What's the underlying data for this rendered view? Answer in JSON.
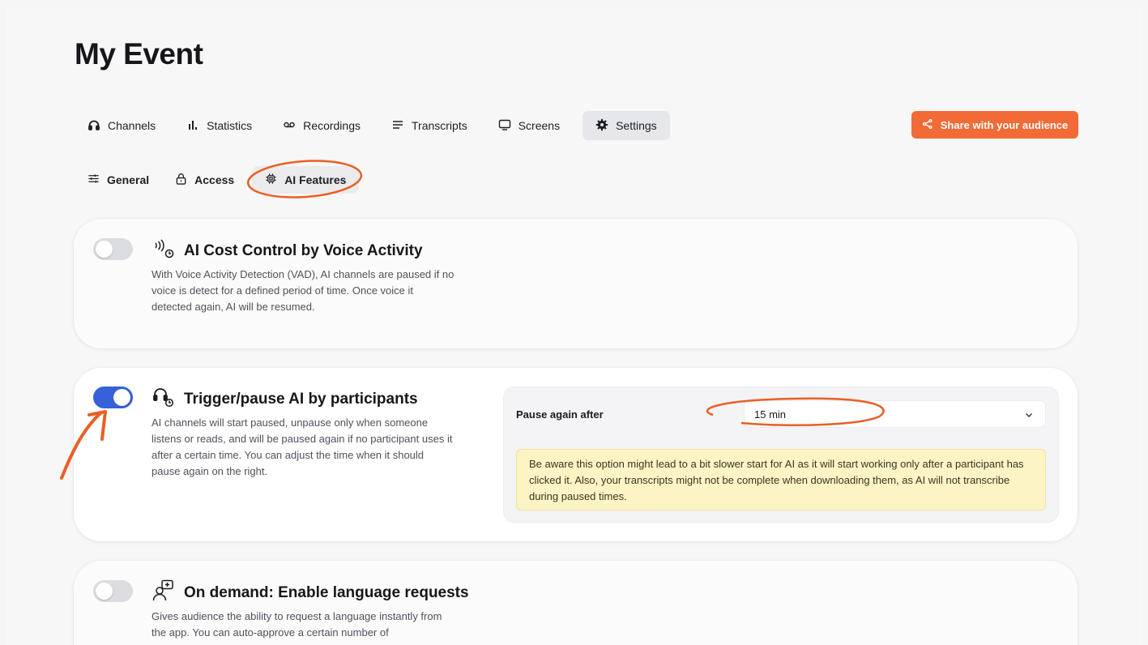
{
  "page_title": "My Event",
  "tabs": [
    {
      "label": "Channels",
      "icon": "headphones-icon"
    },
    {
      "label": "Statistics",
      "icon": "bar-chart-icon"
    },
    {
      "label": "Recordings",
      "icon": "voicemail-icon"
    },
    {
      "label": "Transcripts",
      "icon": "lines-icon"
    },
    {
      "label": "Screens",
      "icon": "monitor-icon"
    },
    {
      "label": "Settings",
      "icon": "gear-icon",
      "active": true
    }
  ],
  "share_button": {
    "label": "Share with your audience",
    "icon": "share-icon",
    "color": "#f26a35"
  },
  "subtabs": [
    {
      "label": "General",
      "icon": "sliders-icon"
    },
    {
      "label": "Access",
      "icon": "lock-icon"
    },
    {
      "label": "AI Features",
      "icon": "chip-icon",
      "active": true
    }
  ],
  "features": [
    {
      "title": "AI Cost Control by Voice Activity",
      "icon": "voice-timer-icon",
      "enabled": false,
      "description": "With Voice Activity Detection (VAD), AI channels are paused if no voice is detect for a defined period of time. Once voice it detected again, AI will be resumed."
    },
    {
      "title": "Trigger/pause AI by participants",
      "icon": "headphones-timer-icon",
      "enabled": true,
      "description": "AI channels will start paused, unpause only when someone listens or reads, and will be paused again if no participant uses it after a certain time. You can adjust the time when it should pause again on the right.",
      "pause_label": "Pause again after",
      "pause_value": "15 min",
      "warning": "Be aware this option might lead to a bit slower start for AI as it will start working only after a participant has clicked it. Also, your transcripts might not be complete when downloading them, as AI will not transcribe during paused times."
    },
    {
      "title": "On demand: Enable language requests",
      "icon": "user-request-icon",
      "enabled": false,
      "description": "Gives audience the ability to request a language instantly from the app. You can auto-approve a certain number of"
    }
  ],
  "colors": {
    "accent": "#f26a35",
    "toggle_on": "#3562d8",
    "warning_bg": "#fdf4c6"
  }
}
